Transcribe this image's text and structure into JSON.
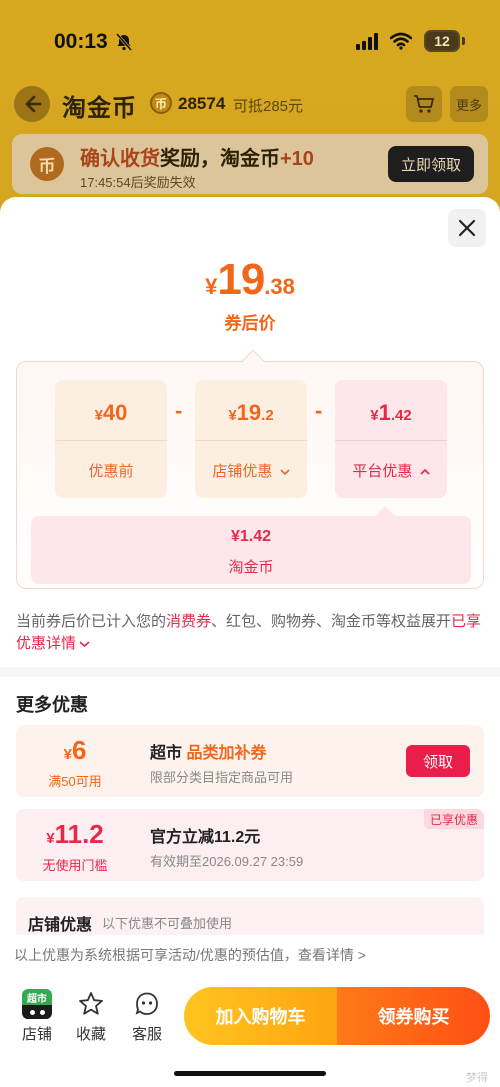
{
  "status_bar": {
    "time": "00:13",
    "battery": "12"
  },
  "nav": {
    "title": "淘金币",
    "coin_symbol": "币",
    "coin_count": "28574",
    "deduct": "可抵285元",
    "more": "更多"
  },
  "banner": {
    "coin_symbol": "币",
    "title_highlight": "确认收货",
    "title_mid": "奖励，淘金币",
    "title_plus": "+10",
    "subtitle": "17:45:54后奖励失效",
    "button": "立即领取"
  },
  "final_price": {
    "symbol": "¥",
    "integer": "19",
    "decimal": ".38",
    "label": "券后价"
  },
  "breakdown": {
    "minus": "-",
    "items": [
      {
        "symbol": "¥",
        "integer": "40",
        "decimal": "",
        "label": "优惠前"
      },
      {
        "symbol": "¥",
        "integer": "19",
        "decimal": ".2",
        "label": "店铺优惠"
      },
      {
        "symbol": "¥",
        "integer": "1",
        "decimal": ".42",
        "label": "平台优惠"
      }
    ],
    "platform_detail": {
      "amount": "¥1.42",
      "label": "淘金币"
    }
  },
  "notice": {
    "pre": "当前券后价已计入您的",
    "hl1": "消费券",
    "mid": "、红包、购物券、淘金币等权益展开",
    "hl2": "已享优惠详情"
  },
  "more_offers": {
    "title": "更多优惠",
    "coupons": [
      {
        "symbol": "¥",
        "value": "6",
        "condition": "满50可用",
        "title_pre": "超市 ",
        "title_hl": "品类加补券",
        "desc": "限部分类目指定商品可用",
        "button": "领取"
      },
      {
        "symbol": "¥",
        "value": "11.2",
        "condition": "无使用门槛",
        "title_pre": "官方立减11.2元",
        "title_hl": "",
        "desc": "有效期至2026.09.27 23:59",
        "tag": "已享优惠"
      }
    ]
  },
  "shop_offers": {
    "title": "店铺优惠",
    "subtitle": "以下优惠不可叠加使用"
  },
  "disclaimer": "以上优惠为系统根据可享活动/优惠的预估值，查看详情 >",
  "bottom_bar": {
    "shop_icon_text": "超市",
    "shop": "店铺",
    "favorite": "收藏",
    "service": "客服",
    "add_cart": "加入购物车",
    "buy": "领券购买",
    "watermark": "梦得"
  }
}
